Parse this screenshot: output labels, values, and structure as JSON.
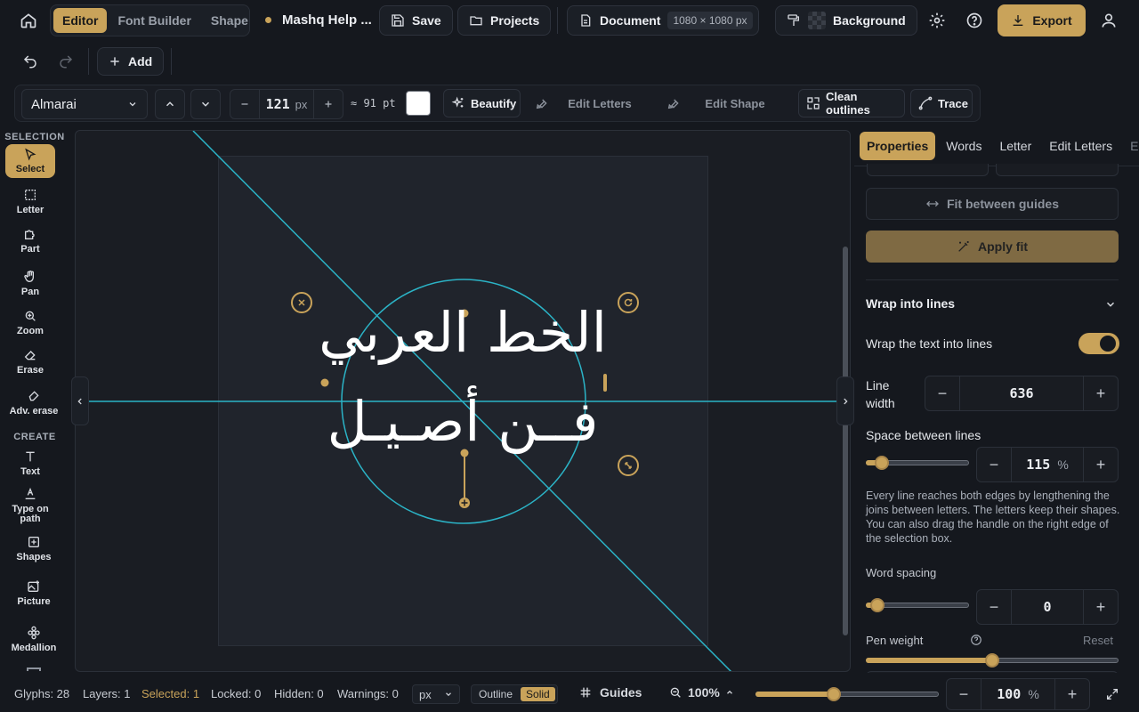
{
  "topbar": {
    "tabs": [
      "Editor",
      "Font Builder",
      "Shape Builder"
    ],
    "project_title": "Mashq Help ...",
    "save_label": "Save",
    "projects_label": "Projects",
    "document_label": "Document",
    "document_size": "1080 × 1080 px",
    "background_label": "Background",
    "export_label": "Export"
  },
  "row2": {
    "add_label": "Add"
  },
  "toolbar": {
    "font": "Almarai",
    "size_value": "121",
    "size_unit": "px",
    "pt_value": "≈ 91 pt",
    "beautify_label": "Beautify",
    "edit_letters_label": "Edit Letters",
    "edit_shape_label": "Edit Shape",
    "clean_outlines_label": "Clean outlines",
    "trace_label": "Trace"
  },
  "sidebar": {
    "selection_header": "SELECTION",
    "create_header": "CREATE",
    "tools": {
      "select": "Select",
      "letter": "Letter",
      "part": "Part",
      "pan": "Pan",
      "zoom": "Zoom",
      "erase": "Erase",
      "adv_erase": "Adv. erase",
      "text": "Text",
      "type_on_path": "Type on path",
      "shapes": "Shapes",
      "picture": "Picture",
      "medallion": "Medallion"
    }
  },
  "canvas": {
    "line1": "الخط العربي",
    "line2": "فــن أصـيـل"
  },
  "panel": {
    "tabs": [
      "Properties",
      "Words",
      "Letter",
      "Edit Letters",
      "Edit"
    ],
    "fit_between_guides": "Fit between guides",
    "apply_fit": "Apply fit",
    "wrap_section_title": "Wrap into lines",
    "wrap_toggle_label": "Wrap the text into lines",
    "wrap_enabled": true,
    "line_width_label": "Line width",
    "line_width_value": "636",
    "space_between_label": "Space between lines",
    "space_between_value": "115",
    "space_between_unit": "%",
    "space_between_fraction": 0.1,
    "wrap_description": "Every line reaches both edges by lengthening the joins between letters. The letters keep their shapes. You can also drag the handle on the right edge of the selection box.",
    "word_spacing_label": "Word spacing",
    "word_spacing_value": "0",
    "word_spacing_fraction": 0.05,
    "pen_weight_label": "Pen weight",
    "pen_weight_reset": "Reset",
    "pen_weight_fraction": 0.5
  },
  "status": {
    "glyphs": "Glyphs: 28",
    "layers": "Layers: 1",
    "selected": "Selected: 1",
    "locked": "Locked: 0",
    "hidden": "Hidden: 0",
    "warnings": "Warnings: 0",
    "unit": "px",
    "outline_label": "Outline",
    "solid_label": "Solid",
    "guides_label": "Guides",
    "zoom_label": "100%",
    "zoom_fraction": 0.42,
    "zoom_value": "100",
    "zoom_unit": "%"
  },
  "colors": {
    "accent": "#c9a35a",
    "guide": "#2bb3c6",
    "background": "#15181e"
  }
}
